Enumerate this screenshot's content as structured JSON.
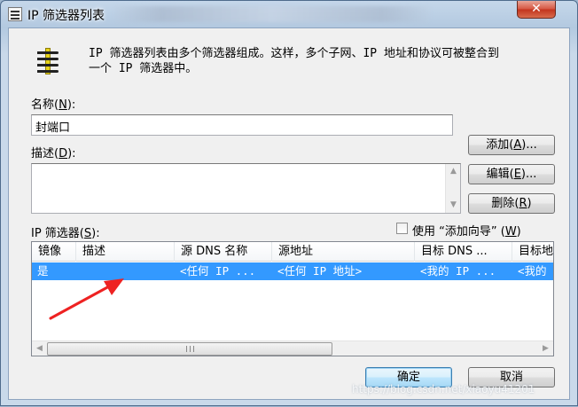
{
  "window": {
    "title": "IP 筛选器列表",
    "close_glyph": "✕"
  },
  "intro": {
    "line1": "IP 筛选器列表由多个筛选器组成。这样，多个子网、IP 地址和协议可被整合到",
    "line2": "一个 IP 筛选器中。"
  },
  "name": {
    "label_prefix": "名称(",
    "label_hotkey": "N",
    "label_suffix": "):",
    "value": "封端口"
  },
  "description": {
    "label_prefix": "描述(",
    "label_hotkey": "D",
    "label_suffix": "):",
    "value": ""
  },
  "buttons": {
    "add_prefix": "添加(",
    "add_hotkey": "A",
    "add_suffix": ")...",
    "edit_prefix": "编辑(",
    "edit_hotkey": "E",
    "edit_suffix": ")...",
    "remove_prefix": "删除(",
    "remove_hotkey": "R",
    "remove_suffix": ")",
    "ok": "确定",
    "cancel": "取消"
  },
  "filters": {
    "label_prefix": "IP 筛选器(",
    "label_hotkey": "S",
    "label_suffix": "):",
    "wizard_checkbox_prefix": "使用 “添加向导” (",
    "wizard_checkbox_hotkey": "W",
    "wizard_checkbox_suffix": ")",
    "wizard_checked": false,
    "columns": [
      "镜像",
      "描述",
      "源 DNS 名称",
      "源地址",
      "目标 DNS ...",
      "目标地"
    ],
    "rows": [
      {
        "mirror": "是",
        "description": "",
        "src_dns": "<任何 IP ...",
        "src_addr": "<任何 IP 地址>",
        "dst_dns": "<我的 IP ...",
        "dst_addr": "<我的"
      }
    ]
  },
  "watermark": "https://blog.csdn.net/xiaoyu41201",
  "colors": {
    "selection": "#3399ff",
    "annotation_arrow": "#ee2222"
  }
}
